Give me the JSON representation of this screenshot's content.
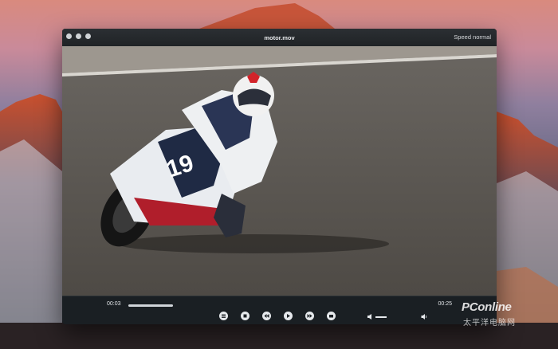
{
  "window": {
    "title": "motor.mov",
    "speed_label": "Speed normal"
  },
  "player": {
    "current_time": "00:03",
    "duration": "00:25",
    "progress_fraction": 0.12,
    "controls": [
      {
        "name": "playlist-button",
        "icon": "playlist-icon"
      },
      {
        "name": "stop-button",
        "icon": "stop-icon"
      },
      {
        "name": "rewind-button",
        "icon": "rewind-icon"
      },
      {
        "name": "play-button",
        "icon": "play-icon"
      },
      {
        "name": "fast-forward-button",
        "icon": "fast-forward-icon"
      },
      {
        "name": "snapshot-button",
        "icon": "camera-icon"
      }
    ]
  },
  "watermark": {
    "logo": "PConline",
    "sub": "太平洋电脑网"
  }
}
